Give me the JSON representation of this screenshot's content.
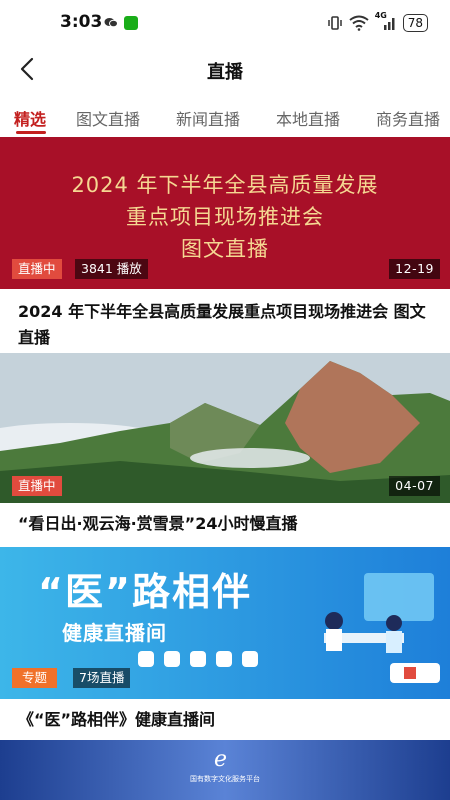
{
  "status_bar": {
    "time": "3:03",
    "signal": "4G",
    "battery": "78"
  },
  "header": {
    "title": "直播"
  },
  "tabs": [
    {
      "label": "精选",
      "active": true
    },
    {
      "label": "图文直播",
      "active": false
    },
    {
      "label": "新闻直播",
      "active": false
    },
    {
      "label": "本地直播",
      "active": false
    },
    {
      "label": "商务直播",
      "active": false
    }
  ],
  "feed": [
    {
      "banner_lines": [
        "2024 年下半年全县高质量发展",
        "重点项目现场推进会",
        "图文直播"
      ],
      "status": "直播中",
      "views": "3841 播放",
      "date": "12-19",
      "title": "2024 年下半年全县高质量发展重点项目现场推进会 图文直播"
    },
    {
      "status": "直播中",
      "date": "04-07",
      "title": "“看日出·观云海·赏雪景”24小时慢直播"
    },
    {
      "banner_title": "“医”路相伴",
      "banner_subtitle": "健康直播间",
      "tag": "专题",
      "count": "7场直播",
      "title": "《“医”路相伴》健康直播间"
    },
    {
      "banner_text": "国有数字文化服务平台"
    }
  ],
  "colors": {
    "accent": "#c3201f",
    "live_badge": "#e14b3e",
    "topic_badge": "#f0712a",
    "banner1_bg": "#a81028",
    "banner1_text": "#f5d792"
  }
}
